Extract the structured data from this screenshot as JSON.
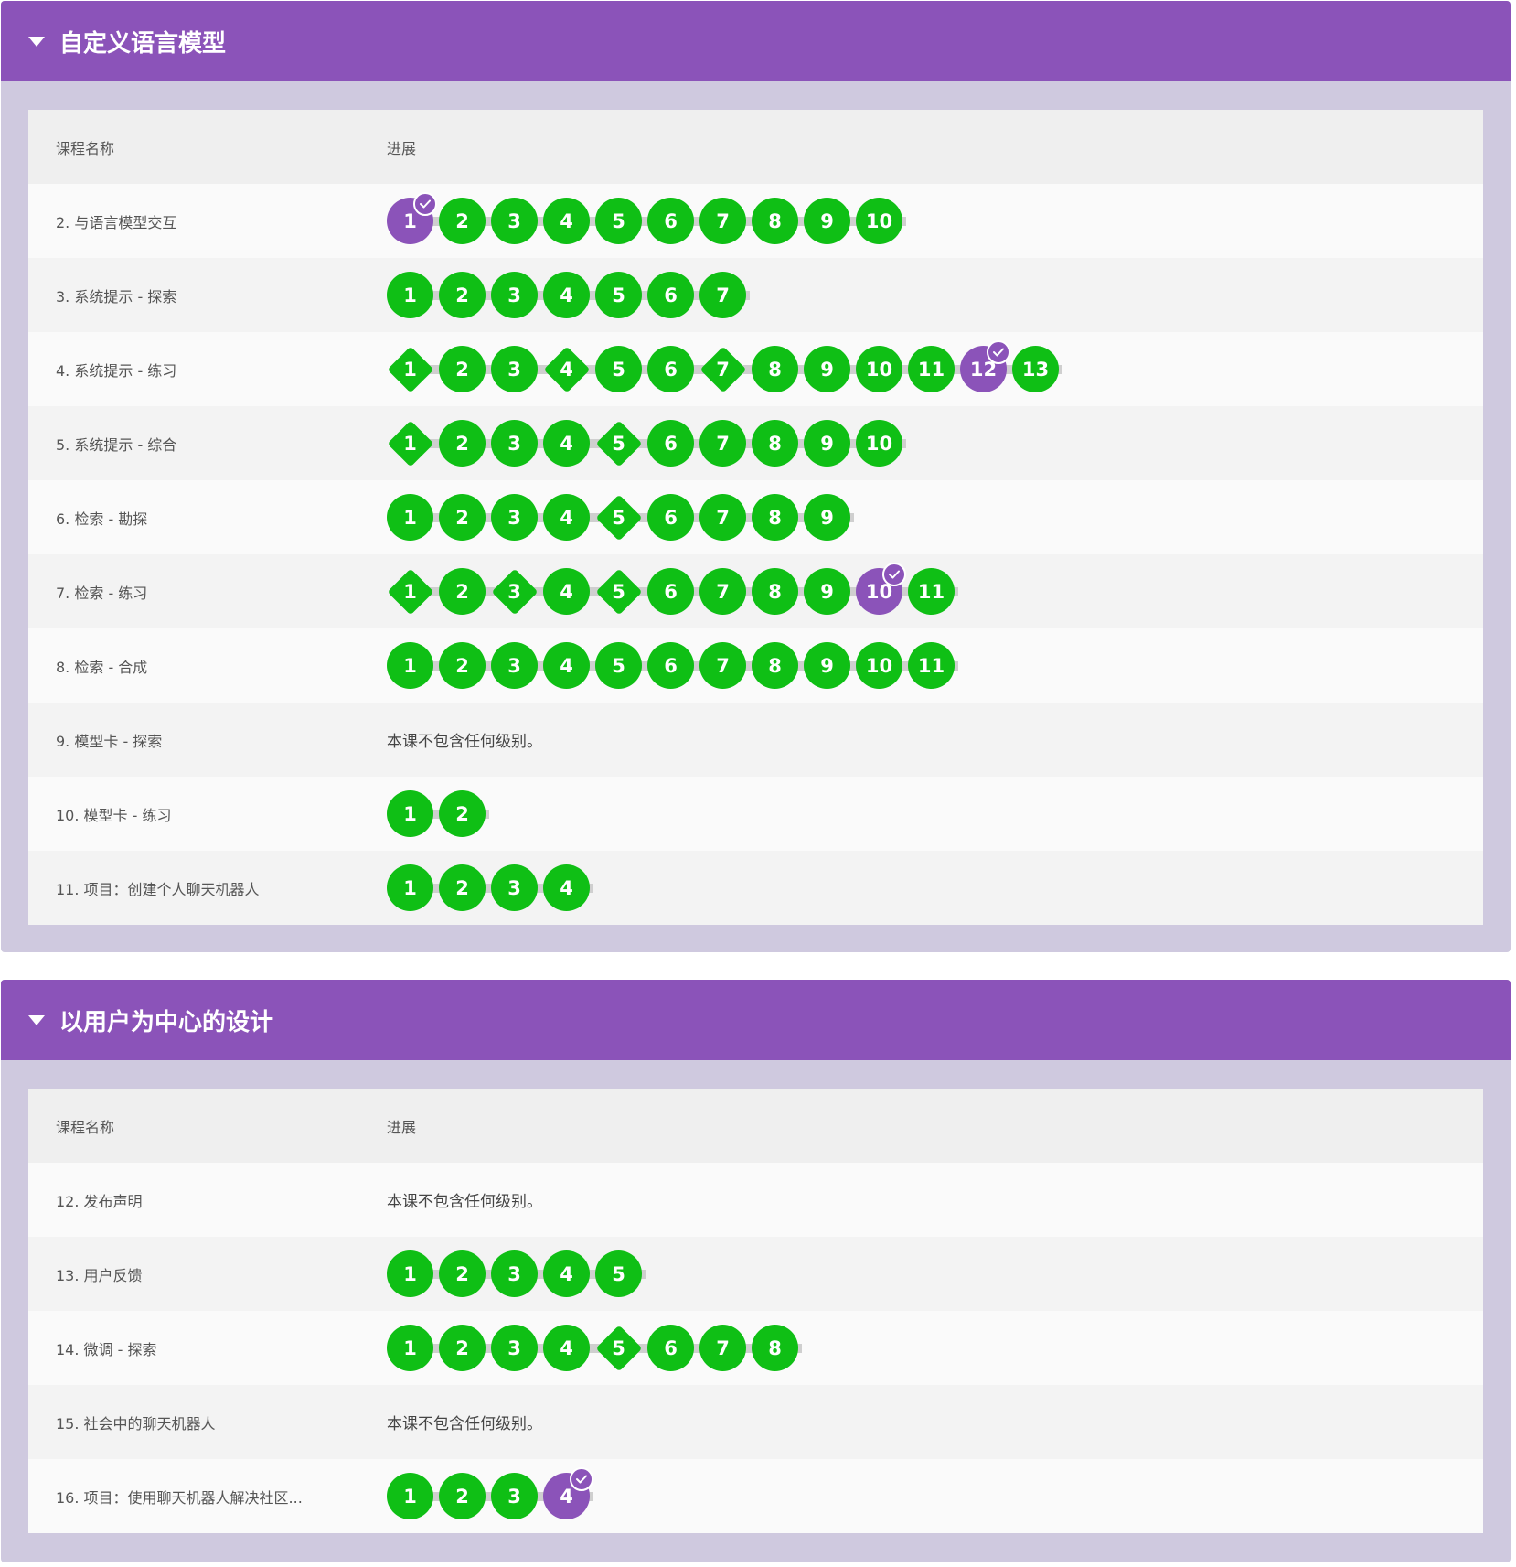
{
  "units": [
    {
      "title": "自定义语言模型",
      "header_name": "课程名称",
      "header_progress": "进展",
      "lessons": [
        {
          "name": "2. 与语言模型交互",
          "levels": [
            {
              "n": "1",
              "shape": "circle",
              "current": true
            },
            {
              "n": "2",
              "shape": "circle"
            },
            {
              "n": "3",
              "shape": "circle"
            },
            {
              "n": "4",
              "shape": "circle"
            },
            {
              "n": "5",
              "shape": "circle"
            },
            {
              "n": "6",
              "shape": "circle"
            },
            {
              "n": "7",
              "shape": "circle"
            },
            {
              "n": "8",
              "shape": "circle"
            },
            {
              "n": "9",
              "shape": "circle"
            },
            {
              "n": "10",
              "shape": "circle"
            }
          ]
        },
        {
          "name": "3. 系统提示 - 探索",
          "levels": [
            {
              "n": "1",
              "shape": "circle"
            },
            {
              "n": "2",
              "shape": "circle"
            },
            {
              "n": "3",
              "shape": "circle"
            },
            {
              "n": "4",
              "shape": "circle"
            },
            {
              "n": "5",
              "shape": "circle"
            },
            {
              "n": "6",
              "shape": "circle"
            },
            {
              "n": "7",
              "shape": "circle"
            }
          ]
        },
        {
          "name": "4. 系统提示 - 练习",
          "levels": [
            {
              "n": "1",
              "shape": "diamond"
            },
            {
              "n": "2",
              "shape": "circle"
            },
            {
              "n": "3",
              "shape": "circle"
            },
            {
              "n": "4",
              "shape": "diamond"
            },
            {
              "n": "5",
              "shape": "circle"
            },
            {
              "n": "6",
              "shape": "circle"
            },
            {
              "n": "7",
              "shape": "diamond"
            },
            {
              "n": "8",
              "shape": "circle"
            },
            {
              "n": "9",
              "shape": "circle"
            },
            {
              "n": "10",
              "shape": "circle"
            },
            {
              "n": "11",
              "shape": "circle"
            },
            {
              "n": "12",
              "shape": "circle",
              "current": true
            },
            {
              "n": "13",
              "shape": "circle"
            }
          ]
        },
        {
          "name": "5. 系统提示 - 综合",
          "levels": [
            {
              "n": "1",
              "shape": "diamond"
            },
            {
              "n": "2",
              "shape": "circle"
            },
            {
              "n": "3",
              "shape": "circle"
            },
            {
              "n": "4",
              "shape": "circle"
            },
            {
              "n": "5",
              "shape": "diamond"
            },
            {
              "n": "6",
              "shape": "circle"
            },
            {
              "n": "7",
              "shape": "circle"
            },
            {
              "n": "8",
              "shape": "circle"
            },
            {
              "n": "9",
              "shape": "circle"
            },
            {
              "n": "10",
              "shape": "circle"
            }
          ]
        },
        {
          "name": "6. 检索 - 勘探",
          "levels": [
            {
              "n": "1",
              "shape": "circle"
            },
            {
              "n": "2",
              "shape": "circle"
            },
            {
              "n": "3",
              "shape": "circle"
            },
            {
              "n": "4",
              "shape": "circle"
            },
            {
              "n": "5",
              "shape": "diamond"
            },
            {
              "n": "6",
              "shape": "circle"
            },
            {
              "n": "7",
              "shape": "circle"
            },
            {
              "n": "8",
              "shape": "circle"
            },
            {
              "n": "9",
              "shape": "circle"
            }
          ]
        },
        {
          "name": "7. 检索 - 练习",
          "levels": [
            {
              "n": "1",
              "shape": "diamond"
            },
            {
              "n": "2",
              "shape": "circle"
            },
            {
              "n": "3",
              "shape": "diamond"
            },
            {
              "n": "4",
              "shape": "circle"
            },
            {
              "n": "5",
              "shape": "diamond"
            },
            {
              "n": "6",
              "shape": "circle"
            },
            {
              "n": "7",
              "shape": "circle"
            },
            {
              "n": "8",
              "shape": "circle"
            },
            {
              "n": "9",
              "shape": "circle"
            },
            {
              "n": "10",
              "shape": "circle",
              "current": true
            },
            {
              "n": "11",
              "shape": "circle"
            }
          ]
        },
        {
          "name": "8. 检索 - 合成",
          "levels": [
            {
              "n": "1",
              "shape": "circle"
            },
            {
              "n": "2",
              "shape": "circle"
            },
            {
              "n": "3",
              "shape": "circle"
            },
            {
              "n": "4",
              "shape": "circle"
            },
            {
              "n": "5",
              "shape": "circle"
            },
            {
              "n": "6",
              "shape": "circle"
            },
            {
              "n": "7",
              "shape": "circle"
            },
            {
              "n": "8",
              "shape": "circle"
            },
            {
              "n": "9",
              "shape": "circle"
            },
            {
              "n": "10",
              "shape": "circle"
            },
            {
              "n": "11",
              "shape": "circle"
            }
          ]
        },
        {
          "name": "9. 模型卡 - 探索",
          "empty_text": "本课不包含任何级别。",
          "levels": []
        },
        {
          "name": "10. 模型卡 - 练习",
          "levels": [
            {
              "n": "1",
              "shape": "circle"
            },
            {
              "n": "2",
              "shape": "circle"
            }
          ]
        },
        {
          "name": "11. 项目：创建个人聊天机器人",
          "levels": [
            {
              "n": "1",
              "shape": "circle"
            },
            {
              "n": "2",
              "shape": "circle"
            },
            {
              "n": "3",
              "shape": "circle"
            },
            {
              "n": "4",
              "shape": "circle"
            }
          ]
        }
      ]
    },
    {
      "title": "以用户为中心的设计",
      "header_name": "课程名称",
      "header_progress": "进展",
      "lessons": [
        {
          "name": "12. 发布声明",
          "empty_text": "本课不包含任何级别。",
          "levels": []
        },
        {
          "name": "13. 用户反馈",
          "levels": [
            {
              "n": "1",
              "shape": "circle"
            },
            {
              "n": "2",
              "shape": "circle"
            },
            {
              "n": "3",
              "shape": "circle"
            },
            {
              "n": "4",
              "shape": "circle"
            },
            {
              "n": "5",
              "shape": "circle"
            }
          ]
        },
        {
          "name": "14. 微调 - 探索",
          "levels": [
            {
              "n": "1",
              "shape": "circle"
            },
            {
              "n": "2",
              "shape": "circle"
            },
            {
              "n": "3",
              "shape": "circle"
            },
            {
              "n": "4",
              "shape": "circle"
            },
            {
              "n": "5",
              "shape": "diamond"
            },
            {
              "n": "6",
              "shape": "circle"
            },
            {
              "n": "7",
              "shape": "circle"
            },
            {
              "n": "8",
              "shape": "circle"
            }
          ]
        },
        {
          "name": "15. 社会中的聊天机器人",
          "empty_text": "本课不包含任何级别。",
          "levels": []
        },
        {
          "name": "16. 项目：使用聊天机器人解决社区...",
          "levels": [
            {
              "n": "1",
              "shape": "circle"
            },
            {
              "n": "2",
              "shape": "circle"
            },
            {
              "n": "3",
              "shape": "circle"
            },
            {
              "n": "4",
              "shape": "circle",
              "current": true
            }
          ]
        }
      ]
    }
  ],
  "colors": {
    "accent_purple": "#8b53b9",
    "level_green": "#0fbf15",
    "unit_background": "#cfc9df"
  },
  "icons": {
    "collapse": "caret-down-icon",
    "current_marker": "check-icon"
  }
}
